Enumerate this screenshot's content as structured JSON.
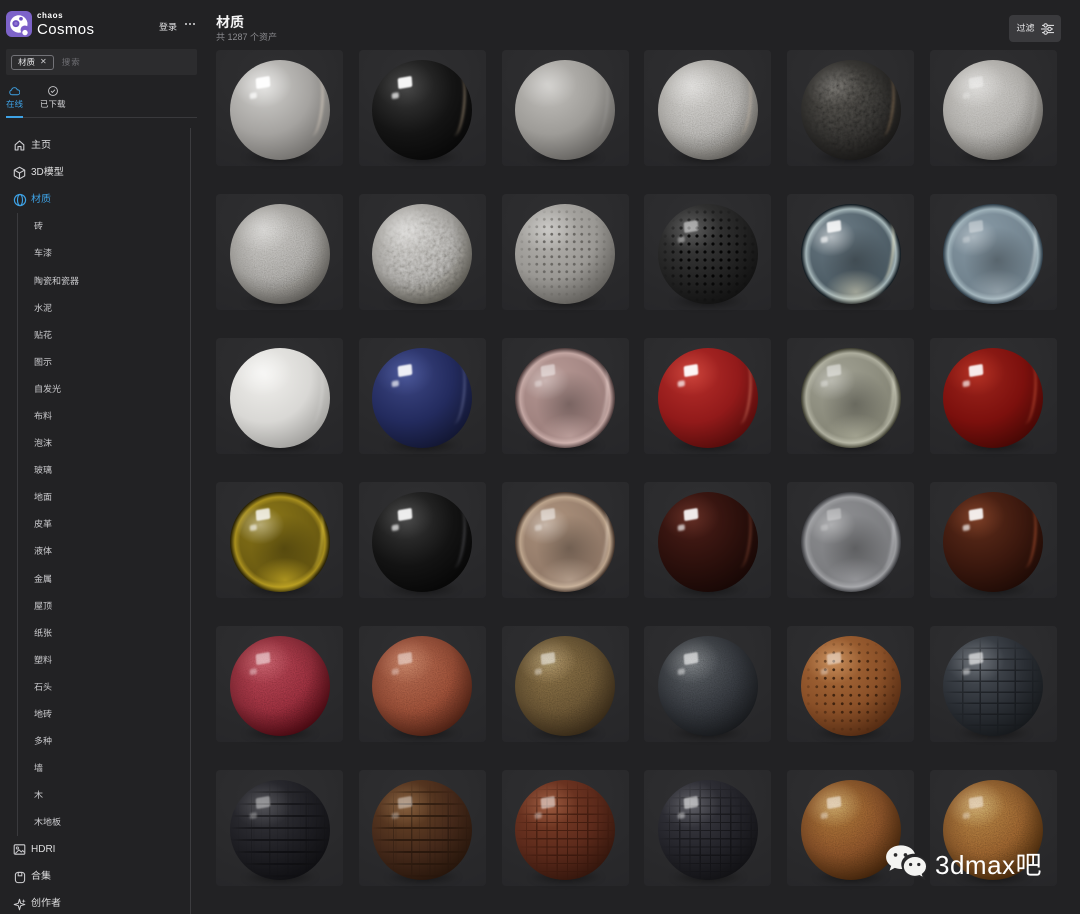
{
  "brand": {
    "small": "chaos",
    "name": "Cosmos",
    "login_label": "登录",
    "more_icon": "ellipsis-icon"
  },
  "search": {
    "tag": "材质",
    "tag_close_icon": "✕",
    "placeholder": "搜索"
  },
  "tabs": [
    {
      "id": "online",
      "label": "在线",
      "icon": "cloud-icon",
      "active": true
    },
    {
      "id": "downloaded",
      "label": "已下载",
      "icon": "check-circle-icon",
      "active": false
    }
  ],
  "sidebar": {
    "items_top": [
      {
        "id": "home",
        "label": "主页",
        "icon": "home-icon",
        "active": false
      },
      {
        "id": "3d-models",
        "label": "3D模型",
        "icon": "cube-icon",
        "active": false
      },
      {
        "id": "materials",
        "label": "材质",
        "icon": "material-sphere-icon",
        "active": true
      }
    ],
    "material_categories": [
      "砖",
      "车漆",
      "陶瓷和瓷器",
      "水泥",
      "贴花",
      "图示",
      "自发光",
      "布料",
      "泡沫",
      "玻璃",
      "地面",
      "皮革",
      "液体",
      "金属",
      "屋顶",
      "纸张",
      "塑料",
      "石头",
      "地砖",
      "多种",
      "墙",
      "木",
      "木地板"
    ],
    "items_bottom": [
      {
        "id": "hdri",
        "label": "HDRI",
        "icon": "hdri-image-icon",
        "active": false
      },
      {
        "id": "collections",
        "label": "合集",
        "icon": "collections-icon",
        "active": false
      },
      {
        "id": "creators",
        "label": "创作者",
        "icon": "creators-icon",
        "active": false
      }
    ]
  },
  "main": {
    "title": "材质",
    "count_text": "共 1287 个资产",
    "filter_label": "过滤",
    "filter_icon": "sliders-icon"
  },
  "watermark": {
    "text": "3dmax吧",
    "icon": "wechat-icon"
  },
  "colors": {
    "accent_blue": "#3ea2e5",
    "page_bg": "#222224",
    "card_bg": "#2a2a2c",
    "brand_purple": "#7c5cc8",
    "text_primary": "#e8e8ea",
    "text_muted": "#8c8c90"
  },
  "grid": {
    "columns": 6,
    "rows": 6,
    "cards": [
      {
        "name": "glossy-white-ceramic",
        "kind": "gloss",
        "colors": [
          "#cfcecb",
          "#a5a3a0",
          "#6e6c69",
          "#454341"
        ],
        "hi": "rgba(255,255,255,.5)",
        "rim": "rgba(255,240,220,.5)",
        "glint": 0.95
      },
      {
        "name": "glossy-black",
        "kind": "gloss",
        "colors": [
          "#3a3a3a",
          "#141414",
          "#070707",
          "#030303"
        ],
        "hi": "rgba(255,255,255,.08)",
        "rim": "rgba(255,225,185,.45)",
        "glint": 0.95
      },
      {
        "name": "matte-light-gray",
        "kind": "gloss",
        "colors": [
          "#c2c0bc",
          "#9e9c98",
          "#5f5d5a",
          "#474542"
        ],
        "hi": "rgba(255,255,255,.3)",
        "rim": "rgba(255,255,255,.12)"
      },
      {
        "name": "stucco-gray",
        "kind": "gloss",
        "colors": [
          "#c6c4c0",
          "#a3a19d",
          "#5e5c58",
          "#474540"
        ],
        "hi": "rgba(255,255,255,.3)",
        "rim": "rgba(255,230,200,.3)",
        "texture": "noise-f",
        "textureOpacity": 0.55
      },
      {
        "name": "rough-black-lava",
        "kind": "gloss",
        "colors": [
          "#45433f",
          "#2b2a28",
          "#171615",
          "#100f0e"
        ],
        "hi": "rgba(255,255,255,.12)",
        "rim": "rgba(255,200,140,.35)",
        "texture": "noise-c",
        "textureOpacity": 0.6
      },
      {
        "name": "fine-grain-light-gray",
        "kind": "gloss",
        "colors": [
          "#c4c2be",
          "#a7a5a1",
          "#615f5b",
          "#4a4844"
        ],
        "hi": "rgba(255,255,255,.35)",
        "rim": "rgba(255,255,255,.15)",
        "texture": "noise-f",
        "textureOpacity": 0.4,
        "glint": 0.35
      },
      {
        "name": "plaster-gray",
        "kind": "gloss",
        "colors": [
          "#bbb9b5",
          "#999793",
          "#575551",
          "#403e3b"
        ],
        "hi": "rgba(255,255,255,.3)",
        "texture": "noise-f",
        "textureOpacity": 0.5
      },
      {
        "name": "wrinkled-gray-plaster",
        "kind": "gloss",
        "colors": [
          "#c0beba",
          "#9c9a96",
          "#525049",
          "#3b3936"
        ],
        "hi": "rgba(255,255,255,.3)",
        "texture": "noise-c",
        "textureOpacity": 0.55
      },
      {
        "name": "perforated-light-gray",
        "kind": "gloss",
        "colors": [
          "#b5b3af",
          "#9a9894",
          "#5b5955",
          "#444240"
        ],
        "hi": "rgba(255,255,255,.3)",
        "texture": "dots",
        "textureOpacity": 0.9,
        "patternColor": "#63615d",
        "dotR": "1.1px",
        "dotGap": "7.5px"
      },
      {
        "name": "perforated-black",
        "kind": "gloss",
        "colors": [
          "#404040",
          "#242424",
          "#101010",
          "#0a0a0a"
        ],
        "hi": "rgba(255,255,255,.15)",
        "texture": "dots",
        "textureOpacity": 0.9,
        "patternColor": "#020202",
        "glint": 0.5,
        "dotR": "1.3px",
        "dotGap": "8px"
      },
      {
        "name": "clear-water-glass",
        "kind": "glass",
        "colors": [
          "#6a7a84",
          "#4a5962",
          "#a4b5b8",
          "#141d23"
        ],
        "glow": "rgba(230,225,195,.55)",
        "glint": 0.85,
        "hi": "rgba(255,255,255,.5)",
        "rim": "rgba(240,235,200,.8)"
      },
      {
        "name": "frosted-blue-glass",
        "kind": "glass",
        "colors": [
          "#8799a5",
          "#6e7f8a",
          "#9fb2ba",
          "#32424e"
        ],
        "glow": "rgba(220,228,232,.3)",
        "glint": 0.35,
        "hi": "rgba(255,255,255,.3)",
        "rim": "rgba(235,240,240,.55)"
      },
      {
        "name": "matte-white",
        "kind": "gloss",
        "colors": [
          "#f0efec",
          "#d9d8d5",
          "#9c9b98",
          "#7b7a77"
        ],
        "hi": "rgba(255,255,255,.5)",
        "rim": "rgba(255,255,255,.2)"
      },
      {
        "name": "glossy-navy-blue",
        "kind": "gloss",
        "colors": [
          "#3d4784",
          "#232b5e",
          "#11152f",
          "#0a0d20"
        ],
        "hi": "rgba(120,140,220,.25)",
        "rim": "rgba(200,210,255,.3)",
        "glint": 0.9
      },
      {
        "name": "rose-translucent-glass",
        "kind": "glass",
        "colors": [
          "#b69894",
          "#9b7e7b",
          "#c3a6a2",
          "#524040"
        ],
        "glow": "rgba(255,225,220,.3)",
        "glint": 0.45,
        "hi": "rgba(255,255,255,.3)",
        "rim": "rgba(255,235,230,.45)"
      },
      {
        "name": "glossy-red-paint",
        "kind": "gloss",
        "colors": [
          "#b62e2a",
          "#921a1a",
          "#500b0a",
          "#320606"
        ],
        "hi": "rgba(255,120,100,.3)",
        "rim": "rgba(255,160,130,.5)",
        "glint": 0.95
      },
      {
        "name": "olive-translucent-glass",
        "kind": "glass",
        "colors": [
          "#a0a092",
          "#848475",
          "#aeae9e",
          "#424234"
        ],
        "glow": "rgba(230,230,205,.3)",
        "glint": 0.45,
        "hi": "rgba(255,255,255,.3)",
        "rim": "rgba(240,240,220,.45)"
      },
      {
        "name": "glossy-dark-red",
        "kind": "gloss",
        "colors": [
          "#9c241c",
          "#7c100d",
          "#420704",
          "#280402"
        ],
        "hi": "rgba(255,90,60,.25)",
        "rim": "rgba(255,120,80,.45)",
        "glint": 0.9
      },
      {
        "name": "amber-glass",
        "kind": "glass",
        "colors": [
          "#8a7618",
          "#675710",
          "#a88f1e",
          "#2a2305"
        ],
        "glow": "rgba(215,185,40,.6)",
        "glint": 0.8,
        "hi": "rgba(255,255,255,.4)",
        "rim": "rgba(235,210,70,.6)"
      },
      {
        "name": "glossy-black-plastic",
        "kind": "gloss",
        "colors": [
          "#383838",
          "#131313",
          "#060606",
          "#020202"
        ],
        "hi": "rgba(255,255,255,.1)",
        "rim": "rgba(220,220,230,.25)",
        "glint": 0.9
      },
      {
        "name": "tan-translucent-glass",
        "kind": "glass",
        "colors": [
          "#ab917c",
          "#8f7766",
          "#bca48c",
          "#48382e"
        ],
        "glow": "rgba(240,220,200,.35)",
        "glint": 0.5,
        "hi": "rgba(255,255,255,.35)",
        "rim": "rgba(245,230,215,.45)"
      },
      {
        "name": "glossy-dark-maroon",
        "kind": "gloss",
        "colors": [
          "#4a1d17",
          "#2c100c",
          "#160705",
          "#0d0403"
        ],
        "hi": "rgba(255,150,120,.15)",
        "rim": "rgba(255,140,100,.3)",
        "glint": 0.9
      },
      {
        "name": "frosted-gray-glass",
        "kind": "glass",
        "colors": [
          "#8d8e91",
          "#797a7d",
          "#9c9da0",
          "#404145"
        ],
        "glow": "rgba(225,225,230,.25)",
        "glint": 0.3,
        "hi": "rgba(255,255,255,.3)",
        "rim": "rgba(235,235,240,.4)"
      },
      {
        "name": "glossy-brown-red",
        "kind": "gloss",
        "colors": [
          "#5e2c1a",
          "#3b180e",
          "#1d0a05",
          "#120603"
        ],
        "hi": "rgba(255,140,90,.2)",
        "rim": "rgba(255,120,70,.45)",
        "glint": 0.9
      },
      {
        "name": "red-leather",
        "kind": "gloss",
        "colors": [
          "#a03a46",
          "#7f2733",
          "#43060e",
          "#2b040a"
        ],
        "hi": "rgba(255,160,160,.25)",
        "texture": "noise-f",
        "textureOpacity": 0.5,
        "glint": 0.5
      },
      {
        "name": "terracotta-leather",
        "kind": "gloss",
        "colors": [
          "#a05a44",
          "#84432f",
          "#471d11",
          "#2e130b"
        ],
        "hi": "rgba(255,180,150,.25)",
        "texture": "noise-f",
        "textureOpacity": 0.45,
        "glint": 0.45
      },
      {
        "name": "brown-leather",
        "kind": "gloss",
        "colors": [
          "#74603c",
          "#5c4a2d",
          "#332615",
          "#20180d"
        ],
        "hi": "rgba(255,230,190,.25)",
        "texture": "noise-f",
        "textureOpacity": 0.45,
        "glint": 0.5
      },
      {
        "name": "black-leather",
        "kind": "gloss",
        "colors": [
          "#4e5256",
          "#2e3136",
          "#15171a",
          "#0d0e10"
        ],
        "hi": "rgba(255,255,255,.18)",
        "texture": "noise-f",
        "textureOpacity": 0.4,
        "glint": 0.6
      },
      {
        "name": "perforated-orange-leather",
        "kind": "gloss",
        "colors": [
          "#ab6c3a",
          "#8a5028",
          "#4e2710",
          "#32190a"
        ],
        "hi": "rgba(255,210,160,.35)",
        "texture": "dots",
        "textureOpacity": 0.85,
        "patternColor": "#321a0a",
        "glint": 0.45,
        "dotR": "1.1px",
        "dotGap": "8.5px"
      },
      {
        "name": "dark-glossy-brick",
        "kind": "gloss",
        "colors": [
          "#4e545c",
          "#2b2f35",
          "#14171a",
          "#0c0e10"
        ],
        "hi": "rgba(255,255,255,.2)",
        "texture": "brick",
        "textureOpacity": 0.55,
        "patternColor": "#0e1013",
        "glint": 0.6
      },
      {
        "name": "black-cracked-planks",
        "kind": "gloss",
        "colors": [
          "#36363c",
          "#1e1e23",
          "#0e0e11",
          "#080809"
        ],
        "hi": "rgba(255,255,255,.15)",
        "texture": "planks",
        "textureOpacity": 0.45,
        "patternColor": "#000004",
        "glint": 0.4
      },
      {
        "name": "brown-cracked-planks",
        "kind": "gloss",
        "colors": [
          "#6a4527",
          "#45291a",
          "#24140a",
          "#150c06"
        ],
        "hi": "rgba(255,210,160,.2)",
        "texture": "planks",
        "textureOpacity": 0.6,
        "patternColor": "#190e06",
        "glint": 0.4
      },
      {
        "name": "red-brown-crocodile",
        "kind": "gloss",
        "colors": [
          "#7e3f28",
          "#5c2a1b",
          "#30140b",
          "#1f0d07"
        ],
        "hi": "rgba(255,180,140,.25)",
        "texture": "croc",
        "textureOpacity": 0.55,
        "patternColor": "#2a0f06",
        "glint": 0.5
      },
      {
        "name": "black-crocodile",
        "kind": "gloss",
        "colors": [
          "#3e3e46",
          "#232329",
          "#101013",
          "#0a0a0c"
        ],
        "hi": "rgba(255,255,255,.18)",
        "texture": "croc",
        "textureOpacity": 0.5,
        "patternColor": "#08080a",
        "glint": 0.55
      },
      {
        "name": "smooth-tan-leather",
        "kind": "gloss",
        "colors": [
          "#9a6832",
          "#774723",
          "#3c2008",
          "#271505"
        ],
        "hi": "rgba(255,220,170,.35)",
        "texture": "noise-f",
        "textureOpacity": 0.4,
        "glint": 0.5
      },
      {
        "name": "grained-tan-leather",
        "kind": "gloss",
        "colors": [
          "#a06f3a",
          "#7e5126",
          "#422508",
          "#2b1806"
        ],
        "hi": "rgba(255,220,170,.35)",
        "texture": "noise-f",
        "textureOpacity": 0.5,
        "glint": 0.45
      }
    ]
  }
}
